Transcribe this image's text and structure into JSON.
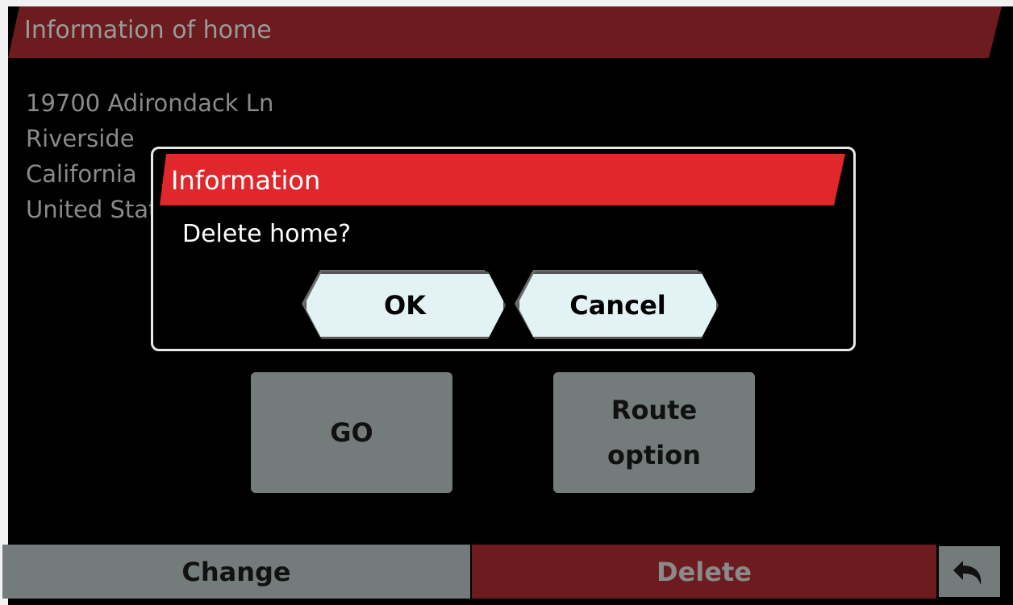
{
  "header": {
    "title": "Information of home"
  },
  "address": {
    "line1": "19700 Adirondack Ln",
    "line2": "Riverside",
    "line3": "California",
    "line4": "United States"
  },
  "actions": {
    "go_label": "GO",
    "route_option_label": "Route option"
  },
  "bottom_bar": {
    "change_label": "Change",
    "delete_label": "Delete",
    "back_icon": "undo-arrow-icon"
  },
  "dialog": {
    "title": "Information",
    "message": "Delete home?",
    "ok_label": "OK",
    "cancel_label": "Cancel"
  },
  "colors": {
    "header_red": "#6c1b1f",
    "dialog_red": "#e0282c",
    "button_gray": "#737b7b",
    "dialog_button": "#e3f2f4"
  }
}
